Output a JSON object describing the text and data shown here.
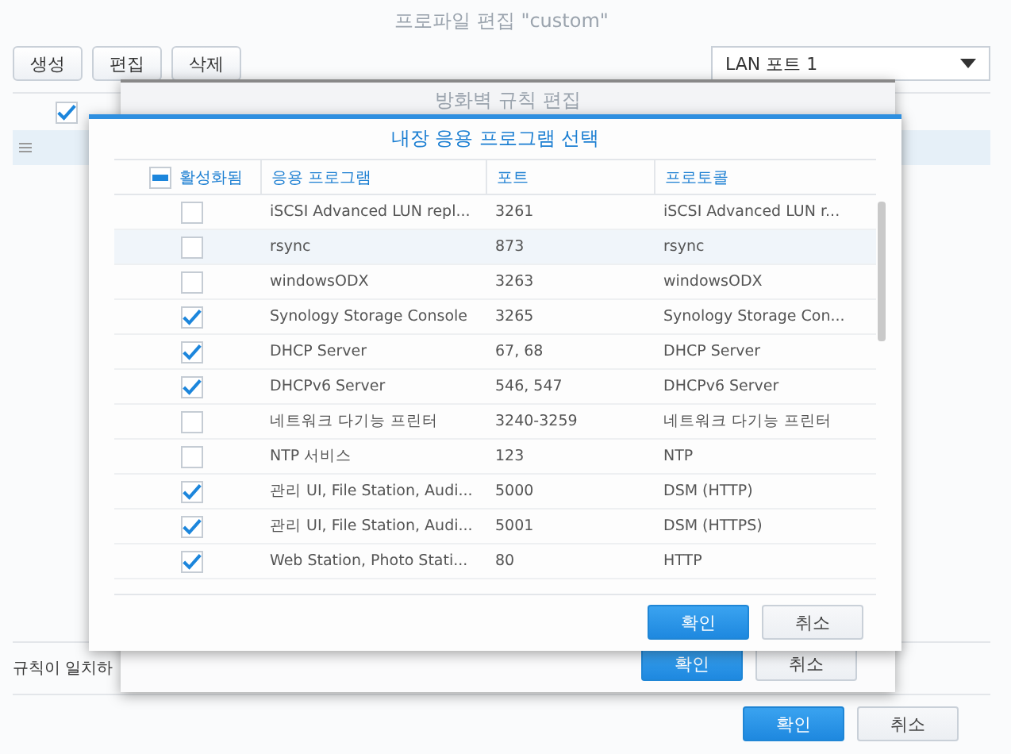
{
  "profile_window": {
    "title": "프로파일 편집 \"custom\"",
    "toolbar": [
      {
        "label": "생성"
      },
      {
        "label": "편집"
      },
      {
        "label": "삭제"
      }
    ],
    "port_select": {
      "value": "LAN 포트 1"
    },
    "rules_table": {
      "header_checked": true
    },
    "footer_text": "규칙이 일치하",
    "buttons": [
      {
        "label": "확인",
        "kind": "primary"
      },
      {
        "label": "취소",
        "kind": "secondary"
      }
    ]
  },
  "rule_dialog": {
    "title": "방화벽 규칙 편집",
    "buttons": [
      {
        "label": "확인",
        "kind": "primary"
      },
      {
        "label": "취소",
        "kind": "secondary"
      }
    ]
  },
  "app_dialog": {
    "title": "내장 응용 프로그램 선택",
    "select_all": {
      "label": "활성화됨",
      "mixed": true
    },
    "columns": [
      "응용 프로그램",
      "포트",
      "프로토콜"
    ],
    "rows": [
      {
        "checked": false,
        "selected": false,
        "application": "iSCSI Advanced LUN repl...",
        "port": "3261",
        "protocol": "iSCSI Advanced LUN r..."
      },
      {
        "checked": false,
        "selected": true,
        "application": "rsync",
        "port": "873",
        "protocol": "rsync"
      },
      {
        "checked": false,
        "selected": false,
        "application": "windowsODX",
        "port": "3263",
        "protocol": "windowsODX"
      },
      {
        "checked": true,
        "selected": false,
        "application": "Synology Storage Console",
        "port": "3265",
        "protocol": "Synology Storage Con..."
      },
      {
        "checked": true,
        "selected": false,
        "application": "DHCP Server",
        "port": "67, 68",
        "protocol": "DHCP Server"
      },
      {
        "checked": true,
        "selected": false,
        "application": "DHCPv6 Server",
        "port": "546, 547",
        "protocol": "DHCPv6 Server"
      },
      {
        "checked": false,
        "selected": false,
        "application": "네트워크 다기능 프린터",
        "port": "3240-3259",
        "protocol": "네트워크 다기능 프린터"
      },
      {
        "checked": false,
        "selected": false,
        "application": "NTP 서비스",
        "port": "123",
        "protocol": "NTP"
      },
      {
        "checked": true,
        "selected": false,
        "application": "관리 UI, File Station, Audi...",
        "port": "5000",
        "protocol": "DSM (HTTP)"
      },
      {
        "checked": true,
        "selected": false,
        "application": "관리 UI, File Station, Audi...",
        "port": "5001",
        "protocol": "DSM (HTTPS)"
      },
      {
        "checked": true,
        "selected": false,
        "application": "Web Station, Photo Stati...",
        "port": "80",
        "protocol": "HTTP"
      }
    ],
    "buttons": [
      {
        "label": "확인",
        "kind": "primary"
      },
      {
        "label": "취소",
        "kind": "secondary"
      }
    ]
  }
}
